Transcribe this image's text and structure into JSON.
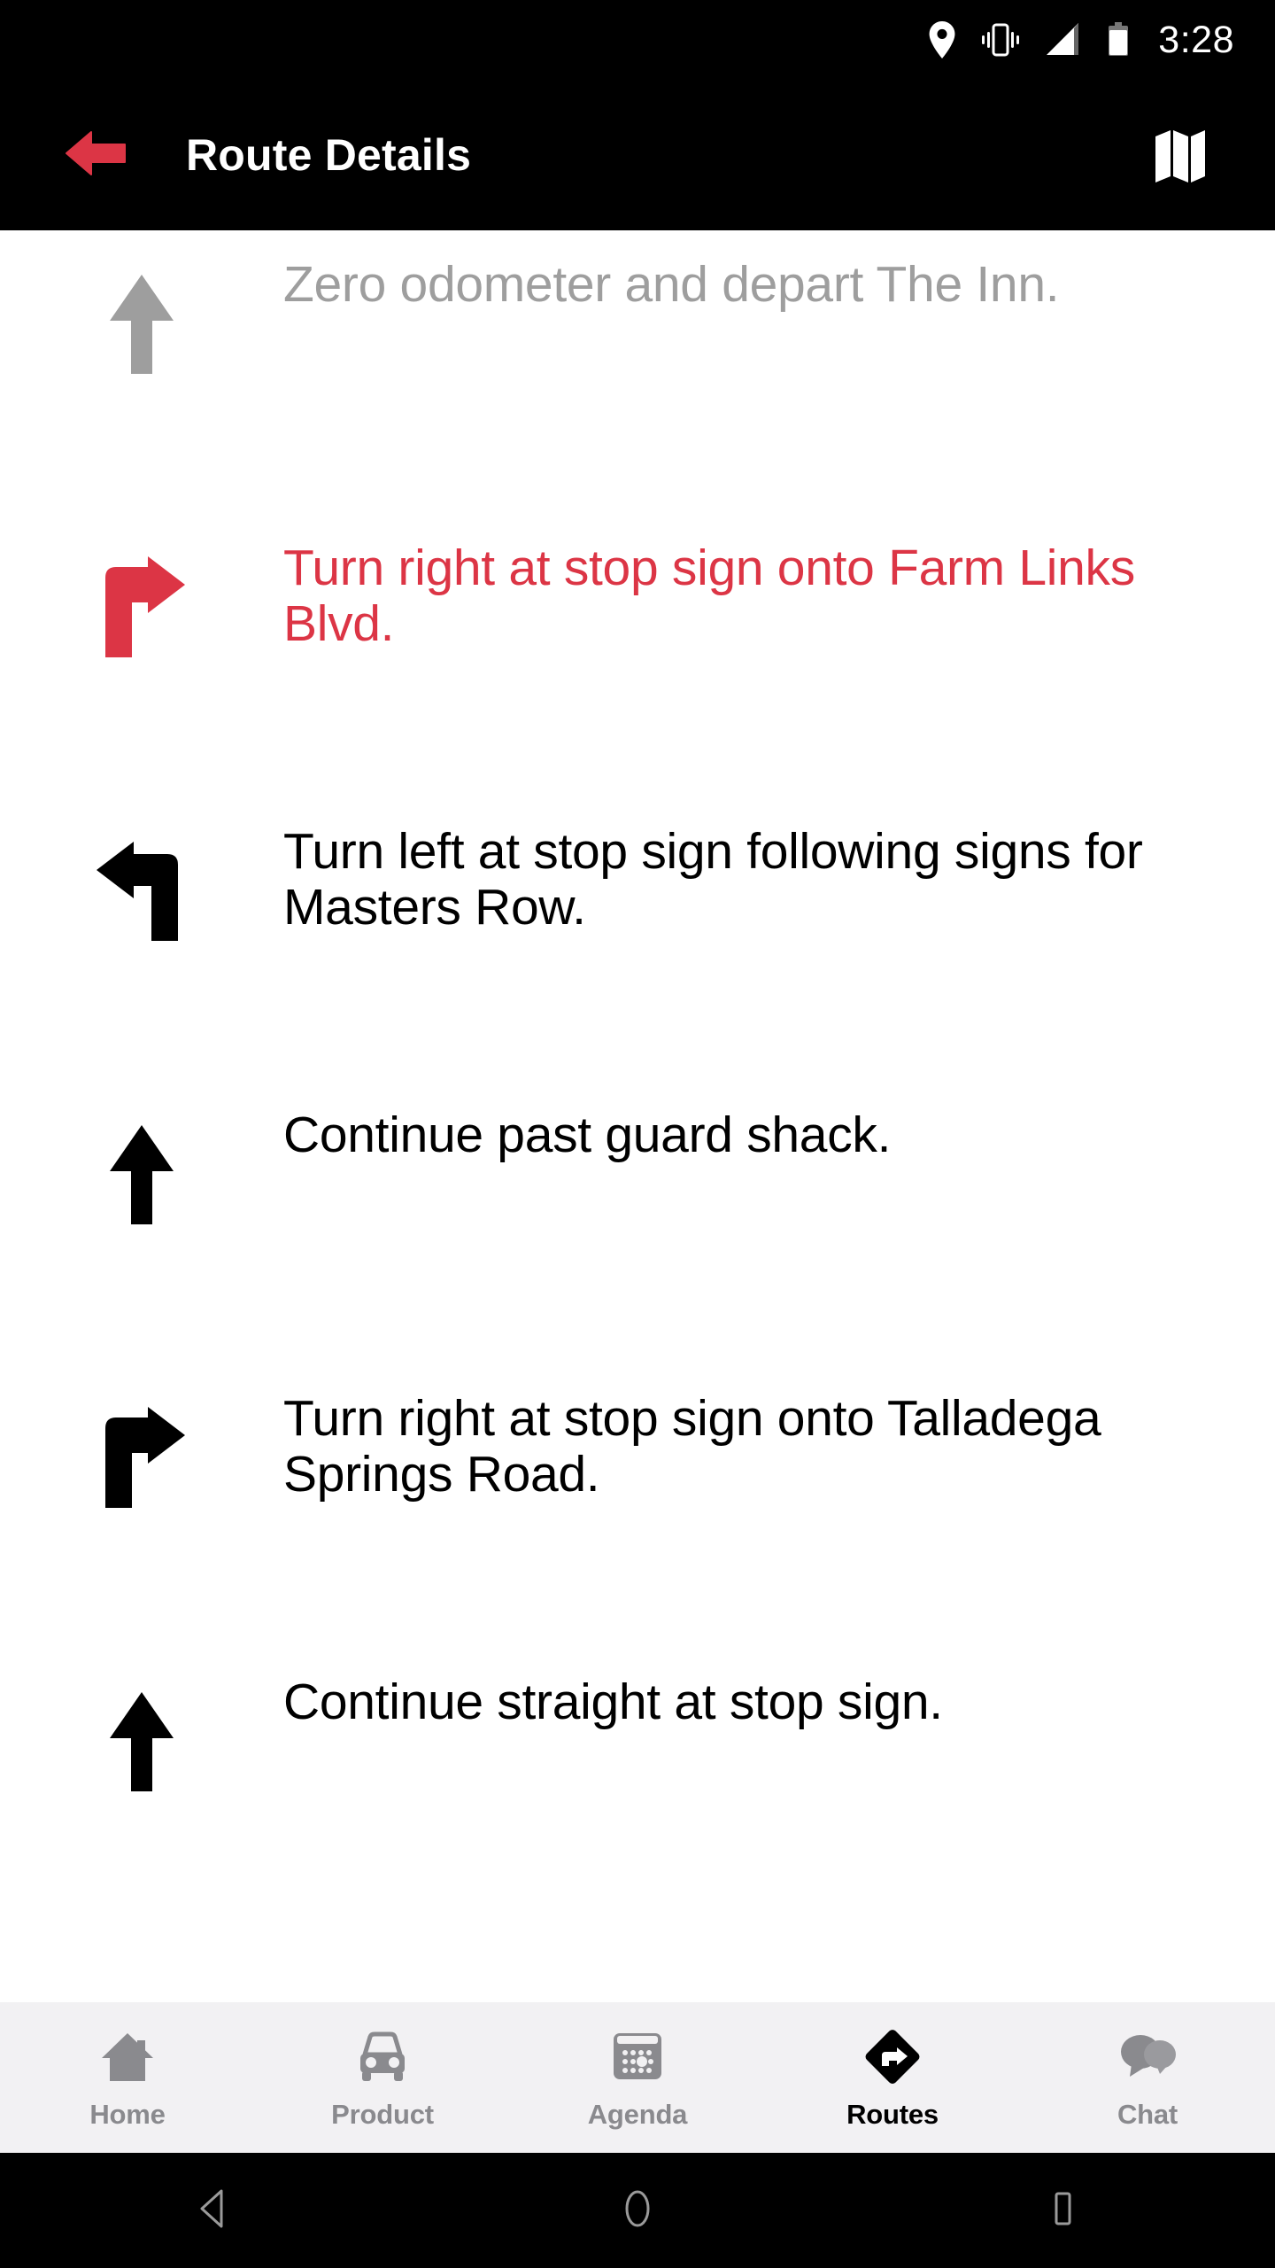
{
  "status_bar": {
    "time": "3:28",
    "icons": [
      "location-pin-icon",
      "vibrate-icon",
      "signal-bars-icon",
      "battery-icon"
    ]
  },
  "app_bar": {
    "back_icon": "arrow-left-icon",
    "title": "Route Details",
    "map_icon": "map-icon",
    "background_color": "#000000",
    "back_icon_color": "#DC3545",
    "title_color": "#FFFFFF"
  },
  "route_steps": [
    {
      "icon": "arrow-up-icon",
      "text": "Zero odometer and depart The Inn.",
      "state": "completed",
      "color": "#9E9E9E"
    },
    {
      "icon": "turn-right-icon",
      "text": "Turn right at stop sign onto Farm Links Blvd.",
      "state": "current",
      "color": "#DC3545"
    },
    {
      "icon": "turn-left-icon",
      "text": "Turn left at stop sign following signs for Masters Row.",
      "state": "upcoming",
      "color": "#000000"
    },
    {
      "icon": "arrow-up-icon",
      "text": "Continue past guard shack.",
      "state": "upcoming",
      "color": "#000000"
    },
    {
      "icon": "turn-right-icon",
      "text": "Turn right at stop sign onto Talladega Springs Road.",
      "state": "upcoming",
      "color": "#000000"
    },
    {
      "icon": "arrow-up-icon",
      "text": "Continue straight at stop sign.",
      "state": "upcoming",
      "color": "#000000"
    }
  ],
  "bottom_nav": {
    "background_color": "#F2F1F3",
    "items": [
      {
        "label": "Home",
        "icon": "home-icon",
        "active": false
      },
      {
        "label": "Product",
        "icon": "car-icon",
        "active": false
      },
      {
        "label": "Agenda",
        "icon": "calendar-icon",
        "active": false
      },
      {
        "label": "Routes",
        "icon": "routes-diamond-icon",
        "active": true
      },
      {
        "label": "Chat",
        "icon": "chat-bubbles-icon",
        "active": false
      }
    ]
  },
  "android_nav": {
    "back_icon": "triangle-back-icon",
    "home_icon": "circle-home-icon",
    "recents_icon": "square-recents-icon"
  }
}
